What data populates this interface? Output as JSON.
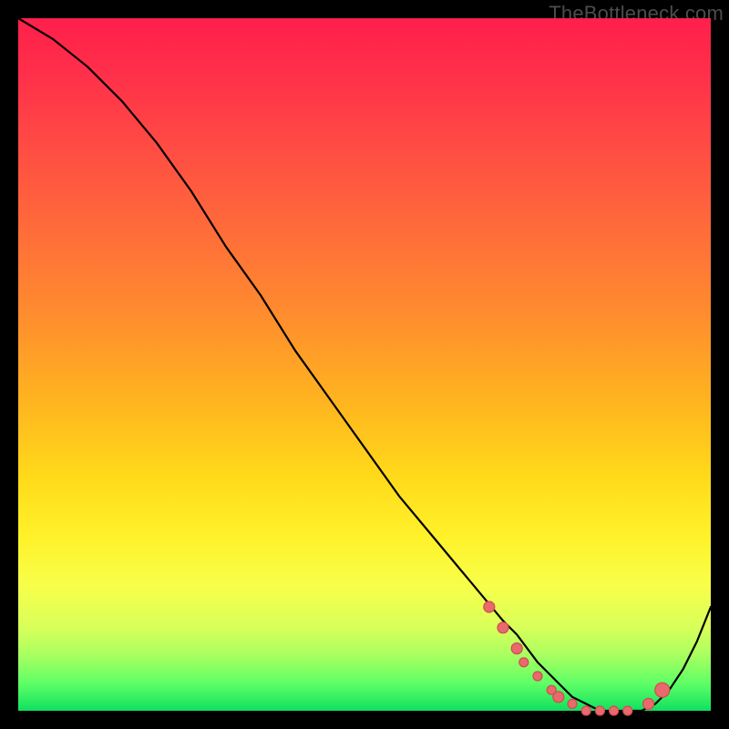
{
  "watermark": "TheBottleneck.com",
  "colors": {
    "marker_fill": "#e96a6d",
    "marker_stroke": "#d24a4e",
    "curve_stroke": "#000000"
  },
  "chart_data": {
    "type": "line",
    "title": "",
    "xlabel": "",
    "ylabel": "",
    "xlim": [
      0,
      100
    ],
    "ylim": [
      0,
      100
    ],
    "grid": false,
    "legend": false,
    "series": [
      {
        "name": "bottleneck-curve",
        "x": [
          0,
          5,
          10,
          15,
          20,
          25,
          30,
          35,
          40,
          45,
          50,
          55,
          60,
          65,
          70,
          72,
          75,
          78,
          80,
          82,
          84,
          86,
          88,
          90,
          92,
          94,
          96,
          98,
          100
        ],
        "y": [
          100,
          97,
          93,
          88,
          82,
          75,
          67,
          60,
          52,
          45,
          38,
          31,
          25,
          19,
          13,
          11,
          7,
          4,
          2,
          1,
          0,
          0,
          0,
          0,
          1,
          3,
          6,
          10,
          15
        ]
      }
    ],
    "markers": {
      "name": "highlight-points",
      "x": [
        68,
        70,
        72,
        73,
        75,
        77,
        78,
        80,
        82,
        84,
        86,
        88,
        91,
        93
      ],
      "y": [
        15,
        12,
        9,
        7,
        5,
        3,
        2,
        1,
        0,
        0,
        0,
        0,
        1,
        3
      ],
      "r": [
        6,
        6,
        6,
        5,
        5,
        5,
        6,
        5,
        5,
        5,
        5,
        5,
        6,
        8
      ]
    }
  }
}
